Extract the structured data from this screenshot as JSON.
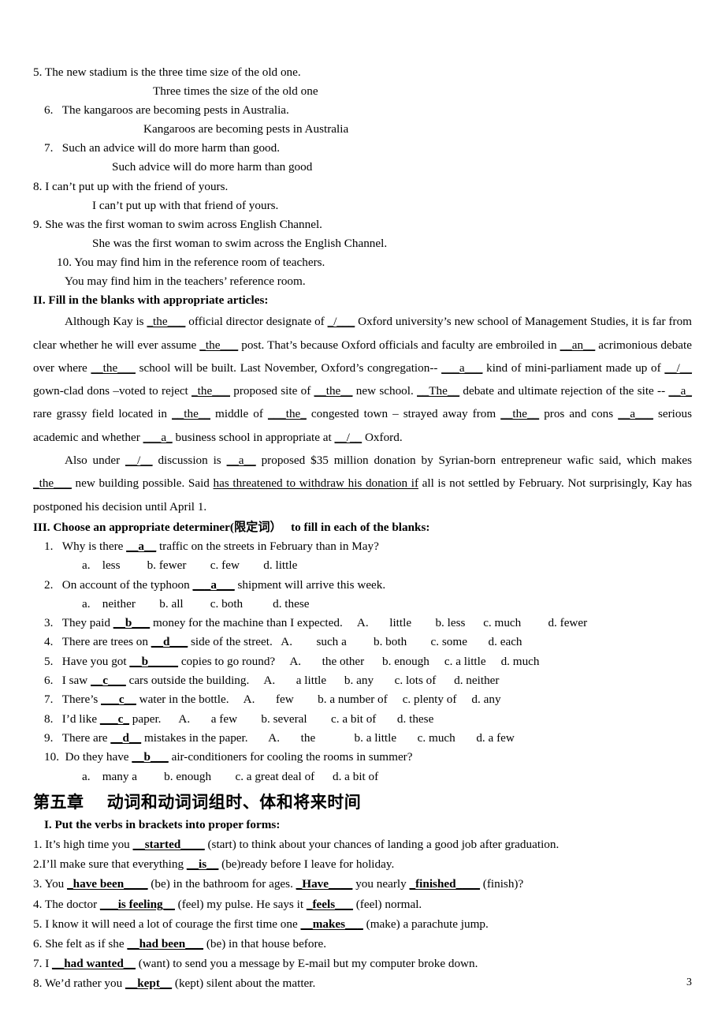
{
  "document": {
    "page_number": "3"
  },
  "section_rewrite": {
    "items": [
      {
        "number": "5.",
        "original": "The new stadium is the three time size of the old one.",
        "answer": "Three times the size of the old one"
      },
      {
        "number": "6.",
        "original": "The kangaroos are becoming pests in Australia.",
        "answer": "Kangaroos are becoming pests in Australia"
      },
      {
        "number": "7.",
        "original": "Such an advice will do more harm than good.",
        "answer": "Such advice will do more harm than good"
      },
      {
        "number": "8.",
        "original": "I can’t put up with the friend of yours.",
        "answer": "I can’t put up with that friend of yours."
      },
      {
        "number": "9.",
        "original": "She was the first woman to swim across English Channel.",
        "answer": "She was the first woman to swim across the English Channel."
      },
      {
        "number": "10.",
        "original": "You may find him in the reference room of teachers.",
        "answer": "You may find him in the teachers’ reference room."
      }
    ]
  },
  "section_two": {
    "heading": "II. Fill in the blanks with appropriate articles:",
    "paragraph_1": {
      "p1": "Although Kay is ",
      "b1": "_the___",
      "p2": " official director designate of ",
      "b2": "_/___",
      "p3": " Oxford university’s new school of Management Studies, it is far from clear whether he will ever assume ",
      "b3": "_the___",
      "p4": " post. That’s because Oxford officials and faculty are embroiled in ",
      "b4": "__an__",
      "p5": " acrimonious debate over where ",
      "b5": "__the___",
      "p6": " school will be built. Last November, Oxford’s congregation-- ",
      "b6": "___a___",
      "p7": " kind of mini-parliament made up of ",
      "b7": "__/__",
      "p8": " gown-clad dons –voted to reject ",
      "b8": "_the___",
      "p9": " proposed site of ",
      "b9": "__the__",
      "p10": " new school. ",
      "b10": "__The__",
      "p11": " debate and ultimate rejection of the site -- ",
      "b11": "__a_",
      "p12": " rare grassy field located in ",
      "b12": "__the__",
      "p13": " middle of ",
      "b13": "___the_",
      "p14": " congested town – strayed away from ",
      "b14": "__the__",
      "p15": " pros and cons ",
      "b15": "__a___",
      "p16": " serious academic and whether ",
      "b16": "___a_",
      "p17": " business school in appropriate at ",
      "b17": "__/__",
      "p18": " Oxford."
    },
    "paragraph_2": {
      "p1": "Also under ",
      "b1": "__/__",
      "p2": " discussion is ",
      "b2": "__a__",
      "p3": " proposed $35 million donation by Syrian-born entrepreneur wafic said, which makes ",
      "b3": "_the___",
      "p4": " new building possible. Said ",
      "u1": "has threatened to withdraw his donation if",
      "p5": " all is not settled by February. Not surprisingly, Kay has postponed his decision until April 1."
    }
  },
  "section_three": {
    "heading": "III. Choose an appropriate determiner(限定词）   to fill in each of the blanks:",
    "questions": [
      {
        "number": "1.",
        "stem_before": "Why is there ",
        "answer": "__a__",
        "stem_after": " traffic on the streets in February than in May?",
        "options_line": "a.    less         b. fewer        c. few        d. little",
        "options_inline": false
      },
      {
        "number": "2.",
        "stem_before": "On account of the typhoon ",
        "answer": "___a___",
        "stem_after": " shipment will arrive this week.",
        "options_line": "a.    neither        b. all         c. both          d. these",
        "options_inline": false
      },
      {
        "number": "3.",
        "stem_before": "They paid ",
        "answer": "__b___",
        "stem_after": " money for the machine than I expected.     A.       little        b. less      c. much         d. fewer",
        "options_line": "",
        "options_inline": true
      },
      {
        "number": "4.",
        "stem_before": "There are trees on ",
        "answer": "__d___",
        "stem_after": " side of the street.   A.        such a         b. both        c. some       d. each",
        "options_line": "",
        "options_inline": true
      },
      {
        "number": "5.",
        "stem_before": "Have you got ",
        "answer": "__b_____",
        "stem_after": " copies to go round?     A.       the other      b. enough     c. a little     d. much",
        "options_line": "",
        "options_inline": true
      },
      {
        "number": "6.",
        "stem_before": "I saw ",
        "answer": "__c___",
        "stem_after": " cars outside the building.     A.       a little      b. any       c. lots of      d. neither",
        "options_line": "",
        "options_inline": true
      },
      {
        "number": "7.",
        "stem_before": "There’s ",
        "answer": "___c__",
        "stem_after": " water in the bottle.     A.       few        b. a number of     c. plenty of     d. any",
        "options_line": "",
        "options_inline": true
      },
      {
        "number": "8.",
        "stem_before": "I’d like ",
        "answer": "___c_",
        "stem_after": " paper.      A.       a few        b. several        c. a bit of       d. these",
        "options_line": "",
        "options_inline": true
      },
      {
        "number": "9.",
        "stem_before": "There are ",
        "answer": "__d__",
        "stem_after": " mistakes in the paper.       A.       the             b. a little       c. much       d. a few",
        "options_line": "",
        "options_inline": true
      },
      {
        "number": "10.",
        "stem_before": "Do they have ",
        "answer": "__b___",
        "stem_after": " air-conditioners for cooling the rooms in summer?",
        "options_line": "a.    many a         b. enough        c. a great deal of      d. a bit of",
        "options_inline": false
      }
    ]
  },
  "chapter_five": {
    "heading": "第五章　 动词和动词词组时、体和将来时间",
    "sub_heading": "I. Put the verbs in brackets into proper forms:",
    "items": [
      {
        "number": "1.",
        "segments": [
          {
            "t": "text",
            "v": "1. It’s high time you "
          },
          {
            "t": "ans",
            "v": "__started____"
          },
          {
            "t": "text",
            "v": " (start) to think about your chances of landing a good job after graduation."
          }
        ]
      },
      {
        "number": "2.",
        "segments": [
          {
            "t": "text",
            "v": "2.I’ll make sure that everything "
          },
          {
            "t": "ans",
            "v": "__is__"
          },
          {
            "t": "text",
            "v": " (be)ready before I leave for holiday."
          }
        ]
      },
      {
        "number": "3.",
        "segments": [
          {
            "t": "text",
            "v": "3. You "
          },
          {
            "t": "ans",
            "v": "_have been____"
          },
          {
            "t": "text",
            "v": " (be) in the bathroom for ages. "
          },
          {
            "t": "ans",
            "v": "_Have____"
          },
          {
            "t": "text",
            "v": " you nearly "
          },
          {
            "t": "ans",
            "v": "_finished____"
          },
          {
            "t": "text",
            "v": " (finish)?"
          }
        ]
      },
      {
        "number": "4.",
        "segments": [
          {
            "t": "text",
            "v": "4. The doctor "
          },
          {
            "t": "ans",
            "v": "___is feeling__"
          },
          {
            "t": "text",
            "v": " (feel) my pulse. He says it "
          },
          {
            "t": "ans",
            "v": "_feels___"
          },
          {
            "t": "text",
            "v": " (feel) normal."
          }
        ]
      },
      {
        "number": "5.",
        "segments": [
          {
            "t": "text",
            "v": "5. I know it will need a lot of courage the first time one "
          },
          {
            "t": "ans",
            "v": "__makes___"
          },
          {
            "t": "text",
            "v": " (make) a parachute jump."
          }
        ]
      },
      {
        "number": "6.",
        "segments": [
          {
            "t": "text",
            "v": "6. She felt as if she "
          },
          {
            "t": "ans",
            "v": "__had been___"
          },
          {
            "t": "text",
            "v": " (be) in that house before."
          }
        ]
      },
      {
        "number": "7.",
        "segments": [
          {
            "t": "text",
            "v": "7. I "
          },
          {
            "t": "ans",
            "v": "__had wanted__"
          },
          {
            "t": "text",
            "v": " (want) to send you a message by E-mail but my computer broke down."
          }
        ]
      },
      {
        "number": "8.",
        "segments": [
          {
            "t": "text",
            "v": "8. We’d rather you "
          },
          {
            "t": "ans",
            "v": "__kept__"
          },
          {
            "t": "text",
            "v": " (kept) silent about the matter."
          }
        ]
      }
    ]
  }
}
